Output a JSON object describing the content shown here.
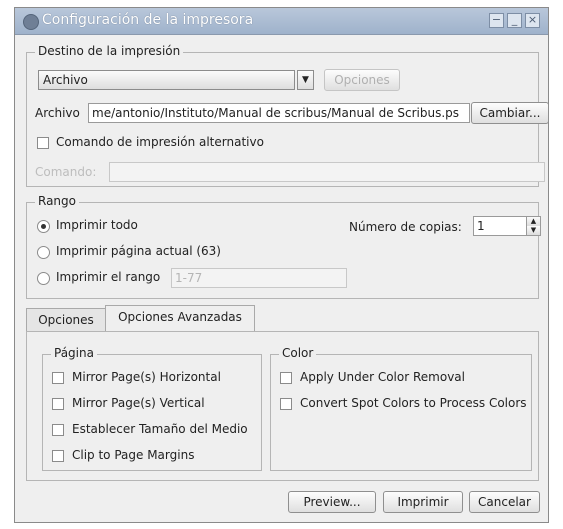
{
  "window": {
    "title": "Configuración de la impresora",
    "controls": [
      "−",
      "_",
      "×"
    ]
  },
  "destino": {
    "legend": "Destino de la impresión",
    "printer_value": "Archivo",
    "options_button": "Opciones",
    "archivo_label": "Archivo",
    "archivo_value": "me/antonio/Instituto/Manual de scribus/Manual de Scribus.ps",
    "cambiar_button": "Cambiar...",
    "alt_command_label": "Comando de impresión alternativo",
    "comando_label": "Comando:",
    "comando_value": ""
  },
  "rango": {
    "legend": "Rango",
    "print_all": "Imprimir todo",
    "print_current": "Imprimir página actual (63)",
    "print_range": "Imprimir el rango",
    "range_value": "1-77",
    "copies_label": "Número de copias:",
    "copies_value": "1"
  },
  "tabs": [
    {
      "label": "Opciones"
    },
    {
      "label": "Opciones Avanzadas"
    }
  ],
  "pagina": {
    "legend": "Página",
    "items": [
      {
        "label": "Mirror Page(s) Horizontal"
      },
      {
        "label": "Mirror Page(s) Vertical"
      },
      {
        "label": "Establecer Tamaño del Medio"
      },
      {
        "label": "Clip to Page Margins"
      }
    ]
  },
  "color": {
    "legend": "Color",
    "items": [
      {
        "label": "Apply Under Color Removal"
      },
      {
        "label": "Convert Spot Colors to Process Colors"
      }
    ]
  },
  "footer": {
    "preview": "Preview...",
    "print": "Imprimir",
    "cancel": "Cancelar"
  }
}
